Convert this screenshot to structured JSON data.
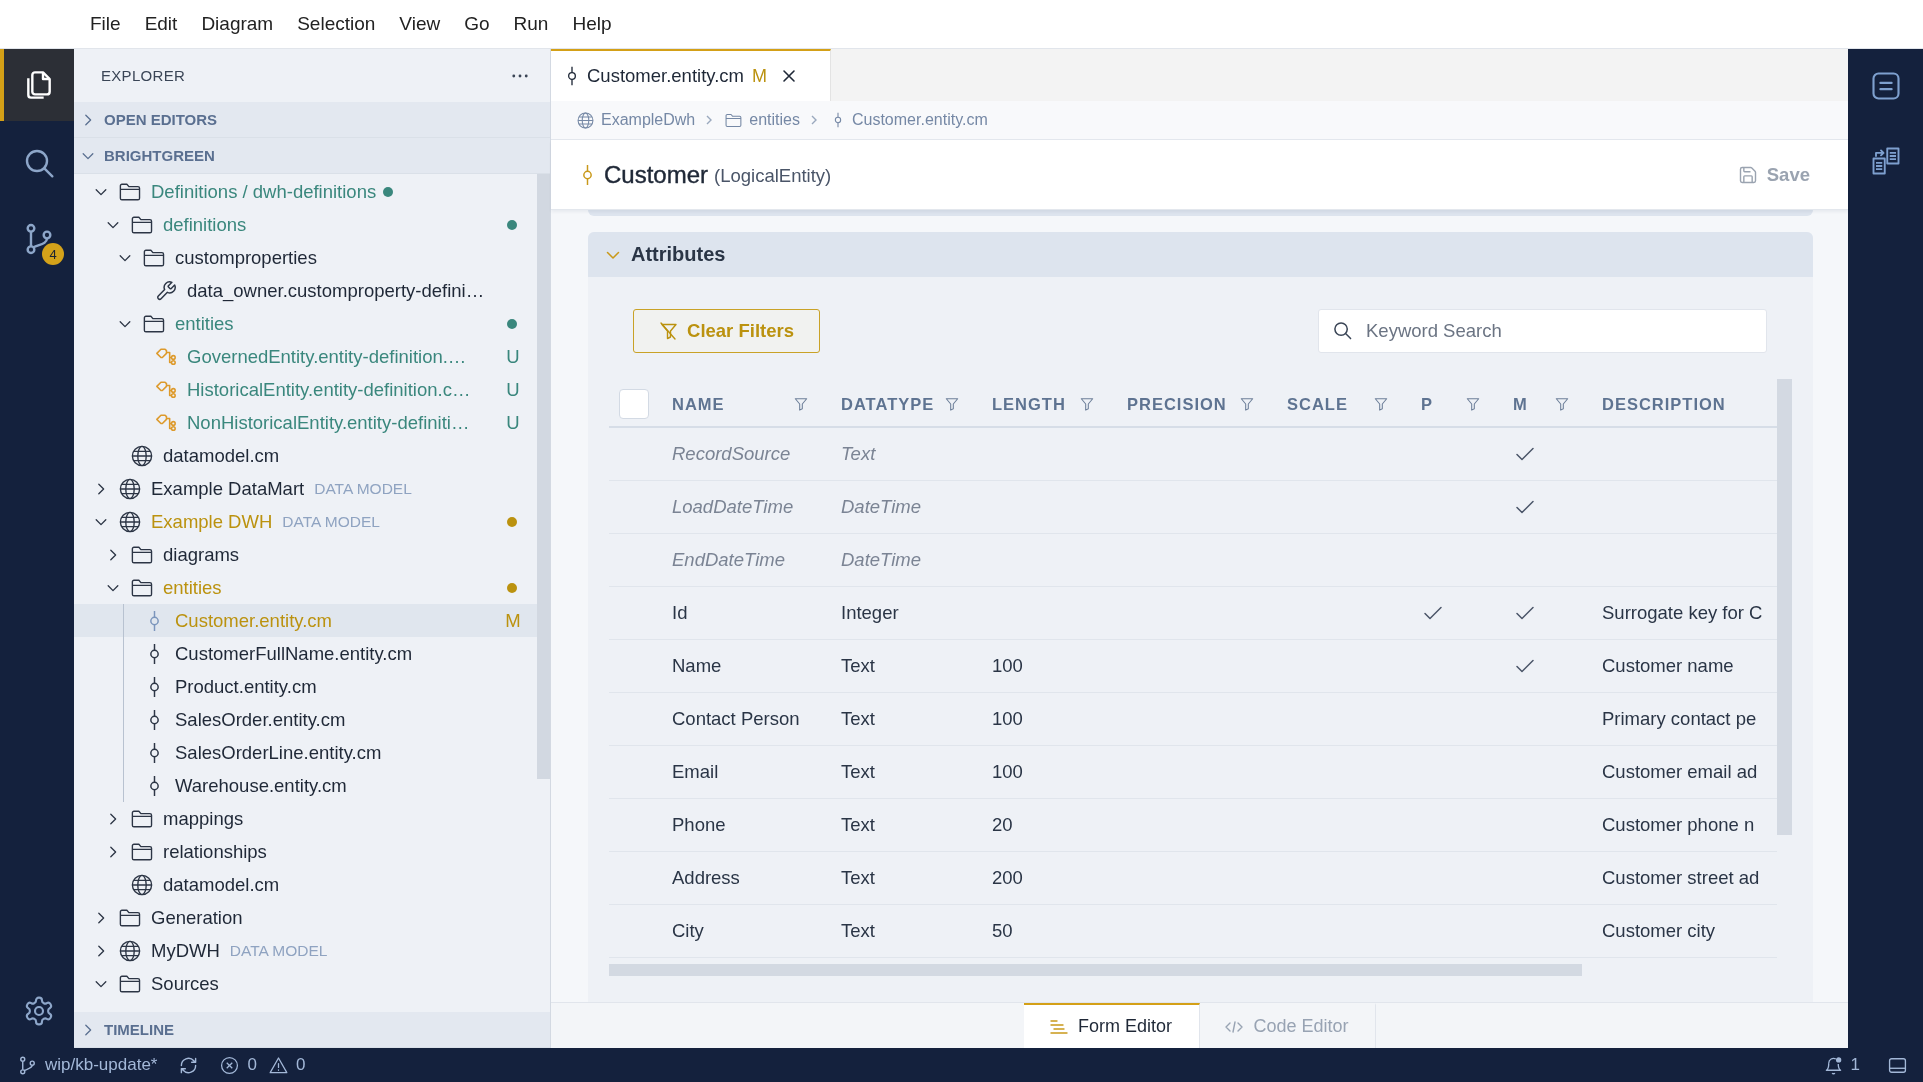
{
  "menu": [
    "File",
    "Edit",
    "Diagram",
    "Selection",
    "View",
    "Go",
    "Run",
    "Help"
  ],
  "activity_bar": {
    "items": [
      {
        "selected": true
      },
      {
        "selected": false
      },
      {
        "selected": false,
        "badge": "4"
      }
    ]
  },
  "sidebar": {
    "title": "EXPLORER",
    "sections": [
      {
        "title": "OPEN EDITORS",
        "expanded": false
      },
      {
        "title": "BRIGHTGREEN",
        "expanded": true,
        "tree": [
          {
            "label": "Definitions / dwh-definitions",
            "kind": "folder",
            "expanded": true,
            "selected": false,
            "color": "#3a877d",
            "dot_after_label": true,
            "children": [
              {
                "label": "definitions",
                "kind": "folder",
                "expanded": true,
                "selected": false,
                "color": "#3a877d",
                "dot_after_label": false,
                "children": [
                  {
                    "label": "customproperties",
                    "kind": "folder",
                    "expanded": true,
                    "selected": false,
                    "children": [
                      {
                        "label": "data_owner.customproperty-defini…",
                        "kind": "property",
                        "selected": false
                      }
                    ]
                  },
                  {
                    "label": "entities",
                    "kind": "folder",
                    "expanded": true,
                    "selected": false,
                    "color": "#3a877d",
                    "dot_after_label": false,
                    "children": [
                      {
                        "label": "GovernedEntity.entity-definition.…",
                        "kind": "definition",
                        "selected": false,
                        "color": "#3a877d",
                        "badge": "U"
                      },
                      {
                        "label": "HistoricalEntity.entity-definition.c…",
                        "kind": "definition",
                        "selected": false,
                        "color": "#3a877d",
                        "badge": "U"
                      },
                      {
                        "label": "NonHistoricalEntity.entity-definiti…",
                        "kind": "definition",
                        "selected": false,
                        "color": "#3a877d",
                        "badge": "U"
                      }
                    ]
                  }
                ]
              },
              {
                "label": "datamodel.cm",
                "kind": "model",
                "selected": false
              }
            ]
          },
          {
            "label": "Example DataMart",
            "kind": "model",
            "tag": "DATA MODEL",
            "expanded": false,
            "selected": false
          },
          {
            "label": "Example DWH",
            "kind": "model",
            "tag": "DATA MODEL",
            "expanded": true,
            "selected": false,
            "color": "#bb920f",
            "dot_after_label": false,
            "children": [
              {
                "label": "diagrams",
                "kind": "folder",
                "expanded": false,
                "selected": false
              },
              {
                "label": "entities",
                "kind": "folder",
                "expanded": true,
                "selected": false,
                "color": "#bb920f",
                "dot_after_label": false,
                "children": [
                  {
                    "label": "Customer.entity.cm",
                    "kind": "entity",
                    "selected": true,
                    "color": "#bb920f",
                    "badge": "M"
                  },
                  {
                    "label": "CustomerFullName.entity.cm",
                    "kind": "entity",
                    "selected": false
                  },
                  {
                    "label": "Product.entity.cm",
                    "kind": "entity",
                    "selected": false
                  },
                  {
                    "label": "SalesOrder.entity.cm",
                    "kind": "entity",
                    "selected": false
                  },
                  {
                    "label": "SalesOrderLine.entity.cm",
                    "kind": "entity",
                    "selected": false
                  },
                  {
                    "label": "Warehouse.entity.cm",
                    "kind": "entity",
                    "selected": false
                  }
                ]
              },
              {
                "label": "mappings",
                "kind": "folder",
                "expanded": false,
                "selected": false
              },
              {
                "label": "relationships",
                "kind": "folder",
                "expanded": false,
                "selected": false
              },
              {
                "label": "datamodel.cm",
                "kind": "model",
                "selected": false
              }
            ]
          },
          {
            "label": "Generation",
            "kind": "folder",
            "expanded": false,
            "selected": false
          },
          {
            "label": "MyDWH",
            "kind": "model",
            "tag": "DATA MODEL",
            "expanded": false,
            "selected": false
          },
          {
            "label": "Sources",
            "kind": "folder",
            "expanded": true,
            "selected": false
          }
        ]
      },
      {
        "title": "TIMELINE",
        "expanded": false
      }
    ]
  },
  "editor": {
    "tabs": [
      {
        "label": "Customer.entity.cm",
        "badge": "M",
        "selected": true
      }
    ],
    "breadcrumb": [
      {
        "label": "ExampleDwh",
        "kind": "model"
      },
      {
        "label": "entities",
        "kind": "folder"
      },
      {
        "label": "Customer.entity.cm",
        "kind": "entity"
      }
    ],
    "header": {
      "title": "Customer",
      "type": "(LogicalEntity)",
      "save_label": "Save"
    },
    "section": {
      "title": "Attributes",
      "expanded": true,
      "clear_filters": "Clear Filters",
      "search": {
        "placeholder": "Keyword Search"
      },
      "table": {
        "select_all": {
          "checked": false
        },
        "columns": [
          {
            "label": "NAME",
            "filter": true
          },
          {
            "label": "DATATYPE",
            "filter": true
          },
          {
            "label": "LENGTH",
            "filter": true
          },
          {
            "label": "PRECISION",
            "filter": true
          },
          {
            "label": "SCALE",
            "filter": true
          },
          {
            "label": "P",
            "filter": true
          },
          {
            "label": "M",
            "filter": true
          },
          {
            "label": "DESCRIPTION",
            "filter": false
          }
        ],
        "rows": [
          {
            "name": "RecordSource",
            "datatype": "Text",
            "system": true,
            "p": false,
            "m": true
          },
          {
            "name": "LoadDateTime",
            "datatype": "DateTime",
            "system": true,
            "p": false,
            "m": true
          },
          {
            "name": "EndDateTime",
            "datatype": "DateTime",
            "system": true,
            "p": false,
            "m": false
          },
          {
            "name": "Id",
            "datatype": "Integer",
            "system": false,
            "p": true,
            "m": true,
            "description": "Surrogate key for C"
          },
          {
            "name": "Name",
            "datatype": "Text",
            "length": "100",
            "system": false,
            "p": false,
            "m": true,
            "description": "Customer name"
          },
          {
            "name": "Contact Person",
            "datatype": "Text",
            "length": "100",
            "system": false,
            "p": false,
            "m": false,
            "description": "Primary contact pe"
          },
          {
            "name": "Email",
            "datatype": "Text",
            "length": "100",
            "system": false,
            "p": false,
            "m": false,
            "description": "Customer email ad"
          },
          {
            "name": "Phone",
            "datatype": "Text",
            "length": "20",
            "system": false,
            "p": false,
            "m": false,
            "description": "Customer phone n"
          },
          {
            "name": "Address",
            "datatype": "Text",
            "length": "200",
            "system": false,
            "p": false,
            "m": false,
            "description": "Customer street ad"
          },
          {
            "name": "City",
            "datatype": "Text",
            "length": "50",
            "system": false,
            "p": false,
            "m": false,
            "description": "Customer city"
          }
        ]
      }
    },
    "view_tabs": [
      {
        "label": "Form Editor",
        "selected": true
      },
      {
        "label": "Code Editor",
        "selected": false
      }
    ]
  },
  "status_bar": {
    "branch": "wip/kb-update*",
    "errors": "0",
    "warnings": "0",
    "notifications": "1"
  }
}
